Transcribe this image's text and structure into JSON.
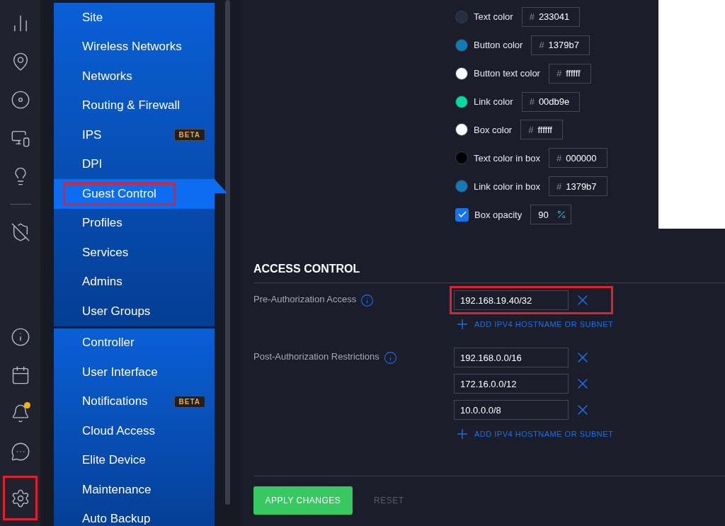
{
  "rail": {
    "notification_badge": true,
    "settings_highlighted": true
  },
  "nav": {
    "groups": [
      {
        "items": [
          {
            "label": "Site",
            "selected": false
          },
          {
            "label": "Wireless Networks",
            "selected": false
          },
          {
            "label": "Networks",
            "selected": false
          },
          {
            "label": "Routing & Firewall",
            "selected": false
          },
          {
            "label": "IPS",
            "selected": false,
            "badge": "BETA"
          },
          {
            "label": "DPI",
            "selected": false
          },
          {
            "label": "Guest Control",
            "selected": true,
            "highlighted": true
          },
          {
            "label": "Profiles",
            "selected": false
          },
          {
            "label": "Services",
            "selected": false
          },
          {
            "label": "Admins",
            "selected": false
          },
          {
            "label": "User Groups",
            "selected": false
          }
        ]
      },
      {
        "items": [
          {
            "label": "Controller",
            "selected": false
          },
          {
            "label": "User Interface",
            "selected": false
          },
          {
            "label": "Notifications",
            "selected": false,
            "badge": "BETA"
          },
          {
            "label": "Cloud Access",
            "selected": false
          },
          {
            "label": "Elite Device",
            "selected": false
          },
          {
            "label": "Maintenance",
            "selected": false
          },
          {
            "label": "Auto Backup",
            "selected": false
          }
        ]
      }
    ]
  },
  "colors": [
    {
      "kind": "color",
      "label": "Text color",
      "prefix": "#",
      "value": "233041",
      "color": "#233041"
    },
    {
      "kind": "color",
      "label": "Button color",
      "prefix": "#",
      "value": "1379b7",
      "color": "#1379b7"
    },
    {
      "kind": "color",
      "label": "Button text color",
      "prefix": "#",
      "value": "ffffff",
      "color": "#ffffff"
    },
    {
      "kind": "color",
      "label": "Link color",
      "prefix": "#",
      "value": "00db9e",
      "color": "#00db9e"
    },
    {
      "kind": "color",
      "label": "Box color",
      "prefix": "#",
      "value": "ffffff",
      "color": "#ffffff"
    },
    {
      "kind": "color",
      "label": "Text color in box",
      "prefix": "#",
      "value": "000000",
      "color": "#000000"
    },
    {
      "kind": "color",
      "label": "Link color in box",
      "prefix": "#",
      "value": "1379b7",
      "color": "#1379b7"
    },
    {
      "kind": "opacity",
      "label": "Box opacity",
      "checked": true,
      "value": "90"
    }
  ],
  "access_control": {
    "title": "ACCESS CONTROL",
    "sections": [
      {
        "label": "Pre-Authorization Access",
        "entries": [
          {
            "value": "192.168.19.40/32",
            "highlighted": true
          }
        ],
        "add_link": "ADD IPV4 HOSTNAME OR SUBNET"
      },
      {
        "label": "Post-Authorization Restrictions",
        "entries": [
          {
            "value": "192.168.0.0/16",
            "highlighted": false
          },
          {
            "value": "172.16.0.0/12",
            "highlighted": false
          },
          {
            "value": "10.0.0.0/8",
            "highlighted": false
          }
        ],
        "add_link": "ADD IPV4 HOSTNAME OR SUBNET"
      }
    ]
  },
  "actions": {
    "apply": "APPLY CHANGES",
    "reset": "RESET"
  }
}
